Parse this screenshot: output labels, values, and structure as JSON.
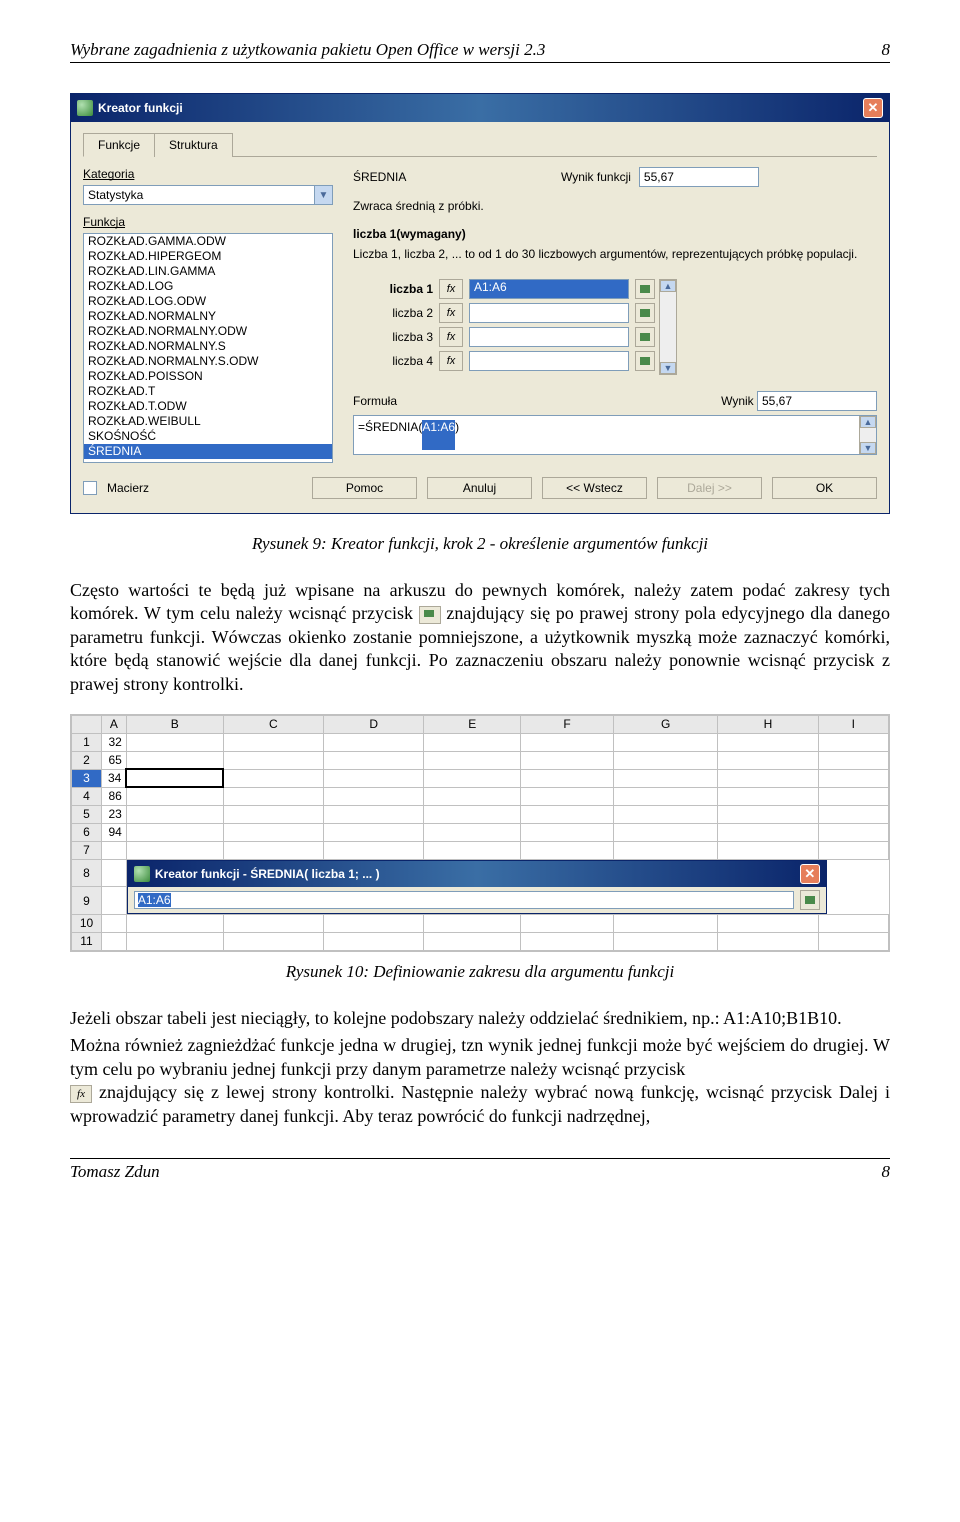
{
  "header": {
    "title": "Wybrane zagadnienia z użytkowania pakietu Open Office w wersji 2.3",
    "pageTop": "8"
  },
  "dialog": {
    "title": "Kreator funkcji",
    "tabs": {
      "funkcje": "Funkcje",
      "struktura": "Struktura"
    },
    "left": {
      "kategoria_label": "Kategoria",
      "kategoria_value": "Statystyka",
      "funkcja_label": "Funkcja",
      "functions": [
        "ROZKŁAD.GAMMA.ODW",
        "ROZKŁAD.HIPERGEOM",
        "ROZKŁAD.LIN.GAMMA",
        "ROZKŁAD.LOG",
        "ROZKŁAD.LOG.ODW",
        "ROZKŁAD.NORMALNY",
        "ROZKŁAD.NORMALNY.ODW",
        "ROZKŁAD.NORMALNY.S",
        "ROZKŁAD.NORMALNY.S.ODW",
        "ROZKŁAD.POISSON",
        "ROZKŁAD.T",
        "ROZKŁAD.T.ODW",
        "ROZKŁAD.WEIBULL",
        "SKOŚNOŚĆ",
        "ŚREDNIA"
      ],
      "selected_index": 14
    },
    "right": {
      "fn_name": "ŚREDNIA",
      "wynik_funkcji_label": "Wynik funkcji",
      "wynik_funkcji_value": "55,67",
      "description": "Zwraca średnią z próbki.",
      "param_title": "liczba 1(wymagany)",
      "param_desc": "Liczba 1, liczba 2, ... to od 1 do 30 liczbowych argumentów, reprezentujących próbkę populacji.",
      "params": [
        {
          "label": "liczba 1",
          "bold": true,
          "value": "A1:A6",
          "selected": true
        },
        {
          "label": "liczba 2",
          "bold": false,
          "value": "",
          "selected": false
        },
        {
          "label": "liczba 3",
          "bold": false,
          "value": "",
          "selected": false
        },
        {
          "label": "liczba 4",
          "bold": false,
          "value": "",
          "selected": false
        }
      ],
      "formula_label": "Formuła",
      "wynik_label": "Wynik",
      "wynik_value": "55,67",
      "formula_prefix": "=ŚREDNIA(",
      "formula_sel": "A1:A6",
      "formula_suffix": ")"
    },
    "bottom": {
      "macierz": "Macierz",
      "pomoc": "Pomoc",
      "anuluj": "Anuluj",
      "wstecz": "<< Wstecz",
      "dalej": "Dalej >>",
      "ok": "OK"
    }
  },
  "caption1": "Rysunek 9: Kreator funkcji, krok 2 - określenie argumentów funkcji",
  "para1a": "Często wartości te będą już wpisane na arkuszu do pewnych komórek, należy zatem podać zakresy tych komórek. W tym celu należy wcisnąć przycisk ",
  "para1b": " znajdujący się po prawej strony pola edycyjnego dla danego parametru funkcji. Wówczas okienko zostanie pomniejszone, a użytkownik myszką może zaznaczyć komórki, które będą stanowić wejście dla danej funkcji. Po zaznaczeniu obszaru należy ponownie wcisnąć przycisk z prawej strony kontrolki.",
  "sheet": {
    "cols": [
      "A",
      "B",
      "C",
      "D",
      "E",
      "F",
      "G",
      "H",
      "I"
    ],
    "rows": [
      {
        "h": "1",
        "a": "32"
      },
      {
        "h": "2",
        "a": "65"
      },
      {
        "h": "3",
        "a": "34",
        "selRow": true,
        "cursorB": true
      },
      {
        "h": "4",
        "a": "86"
      },
      {
        "h": "5",
        "a": "23"
      },
      {
        "h": "6",
        "a": "94"
      },
      {
        "h": "7",
        "a": ""
      },
      {
        "h": "8",
        "a": ""
      },
      {
        "h": "9",
        "a": ""
      },
      {
        "h": "10",
        "a": ""
      },
      {
        "h": "11",
        "a": ""
      }
    ]
  },
  "miniDialog": {
    "title": "Kreator funkcji  - ŚREDNIA( liczba 1; ... )",
    "value": "A1:A6"
  },
  "caption2": "Rysunek 10: Definiowanie zakresu dla argumentu funkcji",
  "para2": "Jeżeli obszar tabeli jest nieciągły, to kolejne podobszary należy oddzielać średnikiem, np.: A1:A10;B1B10.",
  "para3a": "Można również zagnieżdżać funkcje jedna w drugiej, tzn wynik jednej funkcji może być wejściem do drugiej. W tym celu po wybraniu jednej funkcji przy danym parametrze należy wcisnąć przycisk ",
  "para3b": " znajdujący się z lewej strony kontrolki. Następnie należy wybrać nową funkcję, wcisnąć przycisk Dalej i wprowadzić parametry danej funkcji. Aby teraz powrócić do funkcji nadrzędnej,",
  "footer": {
    "author": "Tomasz Zdun",
    "pageBottom": "8"
  },
  "icons": {
    "fx": "fx",
    "close": "✕",
    "dd": "▼",
    "up": "▲",
    "down": "▼"
  }
}
